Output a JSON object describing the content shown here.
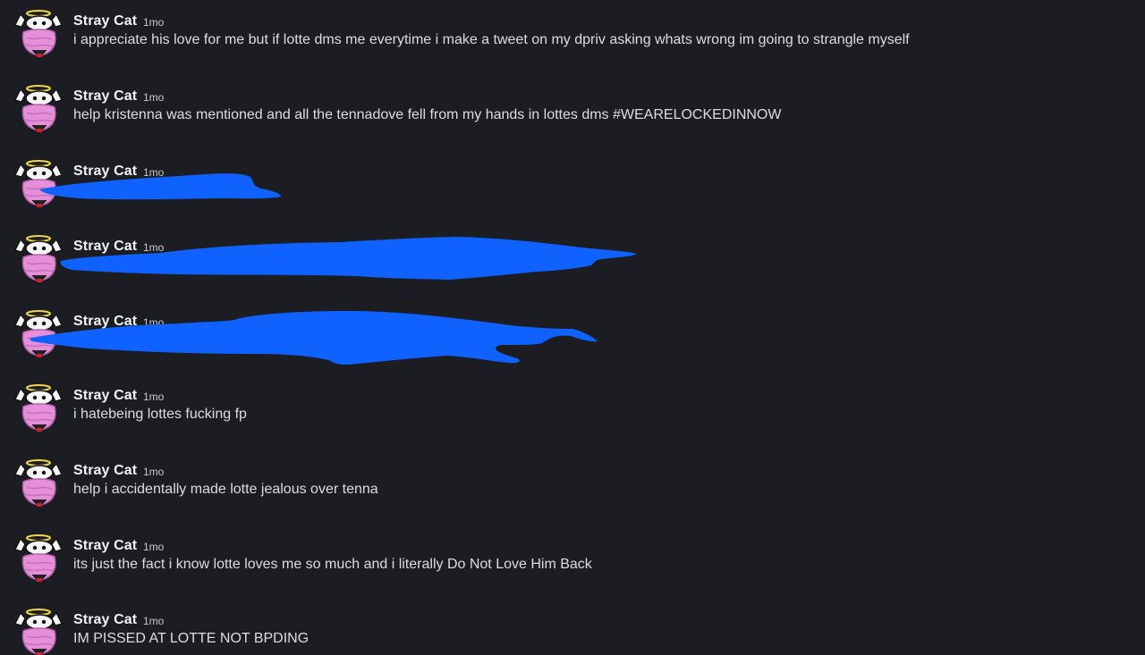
{
  "messages": [
    {
      "author": "Stray Cat",
      "time": "1mo",
      "text": "i appreciate his love for me but if lotte dms me everytime i make a tweet on my dpriv asking whats wrong im going to strangle myself",
      "redacted": false
    },
    {
      "author": "Stray Cat",
      "time": "1mo",
      "text": "help kristenna was mentioned and all the tennadove fell from my hands in lottes dms #WEARELOCKEDINNOW",
      "redacted": false
    },
    {
      "author": "Stray Cat",
      "time": "1mo",
      "text": "",
      "redacted": true
    },
    {
      "author": "Stray Cat",
      "time": "1mo",
      "text": "",
      "redacted": true
    },
    {
      "author": "Stray Cat",
      "time": "1mo",
      "text": "",
      "redacted": true
    },
    {
      "author": "Stray Cat",
      "time": "1mo",
      "text": "i hatebeing lottes fucking fp",
      "redacted": false
    },
    {
      "author": "Stray Cat",
      "time": "1mo",
      "text": "help i accidentally made lotte jealous over tenna",
      "redacted": false
    },
    {
      "author": "Stray Cat",
      "time": "1mo",
      "text": "its just the fact i know lotte loves me so much and i literally Do Not Love Him Back",
      "redacted": false
    },
    {
      "author": "Stray Cat",
      "time": "1mo",
      "text": "IM PISSED AT LOTTE NOT BPDING",
      "redacted": false
    }
  ],
  "colors": {
    "background": "#1c1d22",
    "author": "#f2f3f5",
    "timestamp": "#c8c9ce",
    "message_text": "#dbdee1",
    "redaction": "#0f62fe",
    "avatar_pink": "#e58fd8",
    "halo": "#f0d64a"
  },
  "icons": {
    "avatar": "angel-cat-avatar-icon"
  }
}
